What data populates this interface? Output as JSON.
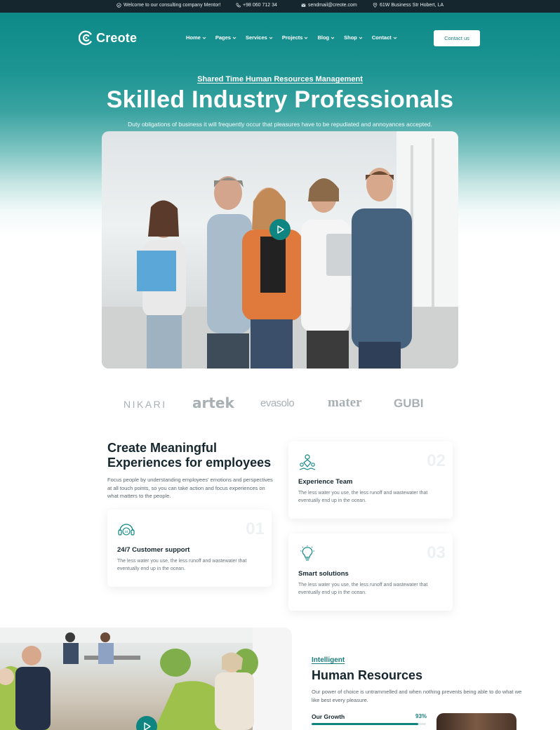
{
  "topbar": {
    "welcome": "Welcome to our consulting company Mentor!",
    "phone": "+98 060 712 34",
    "email": "sendmail@creote.com",
    "address": "61W Business Str Hobert, LA",
    "icons": [
      "check-circle-icon",
      "phone-icon",
      "mail-icon",
      "location-pin-icon"
    ]
  },
  "header": {
    "logo_text": "Creote",
    "nav": [
      "Home",
      "Pages",
      "Services",
      "Projects",
      "Blog",
      "Shop",
      "Contact"
    ],
    "cta": "Contact us"
  },
  "hero": {
    "eyebrow": "Shared Time Human Resources Management",
    "title": "Skilled Industry Professionals",
    "subtitle": "Duty obligations of business it will frequently occur that pleasures have to be repudiated and annoyances accepted."
  },
  "brands": [
    "NIKARI",
    "artek",
    "evasolo",
    "mater",
    "GUBI"
  ],
  "features": {
    "title_line1": "Create Meaningful",
    "title_line2": "Experiences for employees",
    "text": "Focus people by understanding employees' emotions and perspectives at all touch points, so you can take action and focus experiences on what matters to the people.",
    "cards": [
      {
        "num": "02",
        "title": "Experience Team",
        "text": "The less water you use, the less runoff and wastewater that eventually end up in the ocean.",
        "icon": "team-icon"
      },
      {
        "num": "01",
        "title": "24/7 Customer support",
        "text": "The less water you use, the less runoff and wastewater that eventually end up in the ocean.",
        "icon": "headset-icon"
      },
      {
        "num": "03",
        "title": "Smart solutions",
        "text": "The less water you use, the less runoff and wastewater that eventually end up in the ocean.",
        "icon": "lightbulb-icon"
      }
    ]
  },
  "hr": {
    "eyebrow": "Intelligent",
    "title": "Human Resources",
    "text": "Our power of choice is untrammelled and when nothing prevents being able to do what we like best every pleasure.",
    "growth_label": "Our Growth",
    "growth_pct": "93%",
    "growth_value": 0.93
  },
  "colors": {
    "brand": "#0f8582",
    "dark": "#15262e",
    "topbar": "#15262e"
  }
}
